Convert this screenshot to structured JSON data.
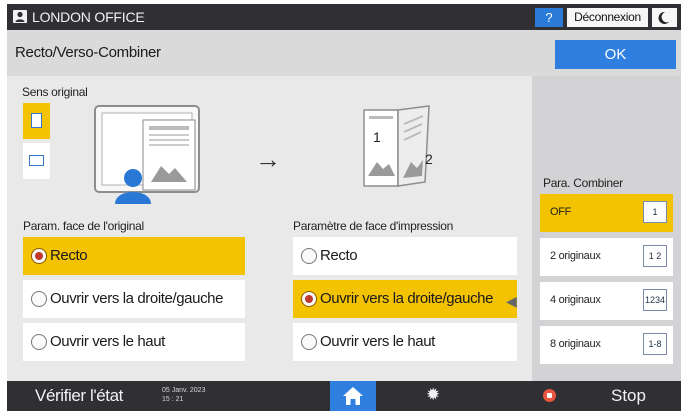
{
  "header": {
    "office_name": "LONDON OFFICE",
    "help_label": "?",
    "logout_label": "Déconnexion"
  },
  "screen": {
    "title": "Recto/Verso-Combiner",
    "ok_label": "OK"
  },
  "original_orientation": {
    "label": "Sens original",
    "options": [
      "portrait",
      "landscape"
    ],
    "selected": "portrait"
  },
  "preview": {
    "arrow": "→",
    "page_left_number": "1",
    "page_right_number": "2"
  },
  "original_sides": {
    "label": "Param. face de l'original",
    "options": [
      "Recto",
      "Ouvrir vers la droite/gauche",
      "Ouvrir vers le haut"
    ],
    "selected": "Recto"
  },
  "print_sides": {
    "label": "Paramètre de face d'impression",
    "options": [
      "Recto",
      "Ouvrir vers la droite/gauche",
      "Ouvrir vers le haut"
    ],
    "selected": "Ouvrir vers la droite/gauche"
  },
  "combine": {
    "label": "Para. Combiner",
    "options": [
      {
        "label": "OFF",
        "thumb": "1"
      },
      {
        "label": "2 originaux",
        "thumb": "1 2"
      },
      {
        "label": "4 originaux",
        "thumb": "1234"
      },
      {
        "label": "8 originaux",
        "thumb": "1-8"
      }
    ],
    "selected": "OFF"
  },
  "footer": {
    "check_status_label": "Vérifier l'état",
    "date_line1": "05 Janv. 2023",
    "date_line2": "15 : 21",
    "stop_label": "Stop"
  },
  "colors": {
    "accent_yellow": "#f3c200",
    "accent_blue": "#2f7fe0",
    "bar_dark": "#2f2f34",
    "stop_red": "#e8563f"
  }
}
